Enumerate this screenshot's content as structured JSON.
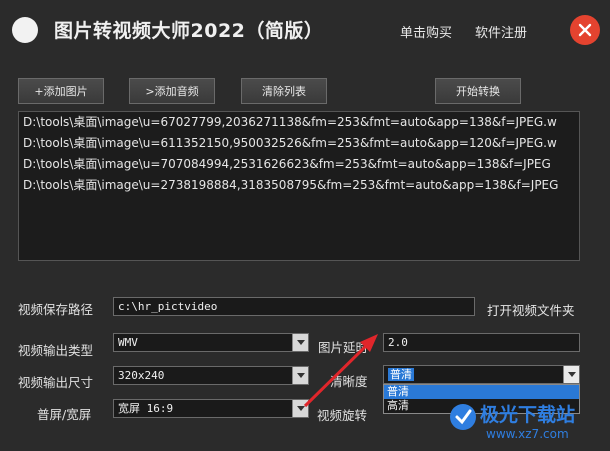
{
  "app": {
    "title": "图片转视频大师2022（简版）",
    "buy_label": "单击购买",
    "register_label": "软件注册"
  },
  "toolbar": {
    "add_image": "+添加图片",
    "add_audio": ">添加音频",
    "clear_list": "清除列表",
    "start_convert": "开始转换"
  },
  "file_list": [
    "D:\\tools\\桌面\\image\\u=67027799,2036271138&fm=253&fmt=auto&app=138&f=JPEG.w",
    "D:\\tools\\桌面\\image\\u=611352150,950032526&fm=253&fmt=auto&app=120&f=JPEG.w",
    "D:\\tools\\桌面\\image\\u=707084994,2531626623&fm=253&fmt=auto&app=138&f=JPEG",
    "D:\\tools\\桌面\\image\\u=2738198884,3183508795&fm=253&fmt=auto&app=138&f=JPEG"
  ],
  "settings": {
    "save_path_label": "视频保存路径",
    "save_path_value": "c:\\hr_pictvideo",
    "open_folder_label": "打开视频文件夹",
    "output_type_label": "视频输出类型",
    "output_type_value": "WMV",
    "image_delay_label": "图片延时",
    "image_delay_value": "2.0",
    "output_size_label": "视频输出尺寸",
    "output_size_value": "320x240",
    "clarity_label": "清晰度",
    "clarity_value": "普清",
    "clarity_options": [
      "普清",
      "高清"
    ],
    "aspect_label": "普屏/宽屏",
    "aspect_value": "宽屏 16:9",
    "rotate_label": "视频旋转"
  },
  "watermark": {
    "line1": "极光下载站",
    "line2": "www.xz7.com"
  },
  "colors": {
    "background": "#2b2b2b",
    "close": "#e4432f",
    "selection": "#2a79d6",
    "annotation_arrow": "#e0262b"
  }
}
